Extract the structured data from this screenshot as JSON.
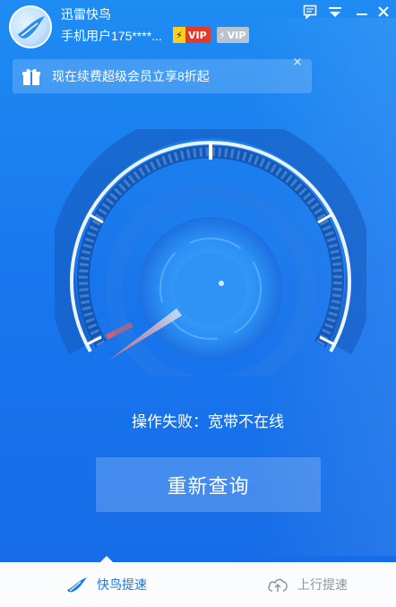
{
  "app": {
    "title": "迅雷快鸟"
  },
  "user": {
    "name": "手机用户175****..."
  },
  "vip": {
    "gold_label": "VIP",
    "gray_label": "VIP"
  },
  "promo": {
    "text": "现在续费超级会员立享8折起",
    "close": "×"
  },
  "speedtest": {
    "status": "操作失败：宽带不在线",
    "retry_label": "重新查询"
  },
  "tabs": [
    {
      "label": "快鸟提速",
      "active": true
    },
    {
      "label": "上行提速",
      "active": false
    }
  ],
  "colors": {
    "background": "#1877ee",
    "accent": "#1a78e8",
    "vip_red": "#e23b2c",
    "vip_gold": "#ffcf1a",
    "inactive_tab": "#8d95a1"
  }
}
